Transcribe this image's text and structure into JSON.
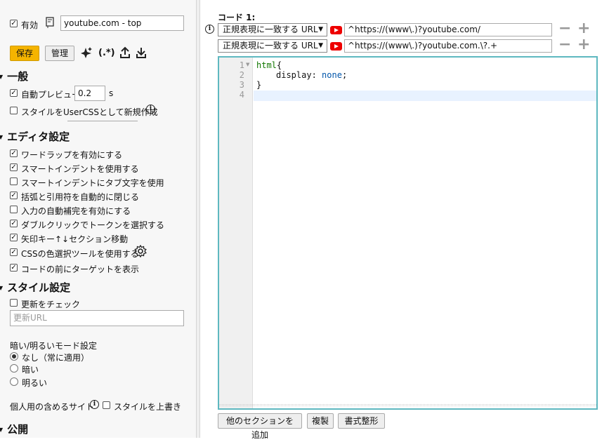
{
  "sidebar": {
    "enabled_label": "有効",
    "style_name": "youtube.com - top",
    "save_label": "保存",
    "manage_label": "管理",
    "regex_label": "(.*)",
    "general": {
      "heading": "一般",
      "live_preview_label": "自動プレビュー",
      "live_preview_value": "0.2",
      "live_preview_unit": "s",
      "usercss_label": "スタイルをUserCSSとして新規作成"
    },
    "editor_settings": {
      "heading": "エディタ設定",
      "options": [
        {
          "label": "ワードラップを有効にする",
          "checked": true
        },
        {
          "label": "スマートインデントを使用する",
          "checked": true
        },
        {
          "label": "スマートインデントにタブ文字を使用",
          "checked": false
        },
        {
          "label": "括弧と引用符を自動的に閉じる",
          "checked": true
        },
        {
          "label": "入力の自動補完を有効にする",
          "checked": false
        },
        {
          "label": "ダブルクリックでトークンを選択する",
          "checked": true
        },
        {
          "label": "矢印キー↑↓セクション移動",
          "checked": true
        },
        {
          "label": "CSSの色選択ツールを使用する",
          "checked": true
        },
        {
          "label": "コードの前にターゲットを表示",
          "checked": true
        }
      ]
    },
    "style_settings": {
      "heading": "スタイル設定",
      "check_updates_label": "更新をチェック",
      "update_url_placeholder": "更新URL",
      "dark_mode_label": "暗い/明るいモード設定",
      "dark_mode_options": [
        {
          "label": "なし（常に適用）",
          "selected": true
        },
        {
          "label": "暗い",
          "selected": false
        },
        {
          "label": "明るい",
          "selected": false
        }
      ],
      "personal_sites_label": "個人用の含めるサイト",
      "override_label": "スタイルを上書き"
    },
    "publish": {
      "heading": "公開"
    }
  },
  "main": {
    "section_label": "コード 1:",
    "targets": [
      {
        "type": "正規表現に一致する URL",
        "value": "^https://(www\\.)?youtube.com/"
      },
      {
        "type": "正規表現に一致する URL",
        "value": "^https://(www\\.)?youtube.com.\\?.+"
      }
    ],
    "code_lines": [
      "1",
      "2",
      "3",
      "4"
    ],
    "code": {
      "line1_selector": "html",
      "line1_brace": "{",
      "line2_prop": "display",
      "line2_colon": ": ",
      "line2_value": "none",
      "line2_semicolon": ";",
      "line3": "}"
    },
    "add_section_label": "他のセクションを追加",
    "clone_label": "複製",
    "beautify_label": "書式整形"
  }
}
